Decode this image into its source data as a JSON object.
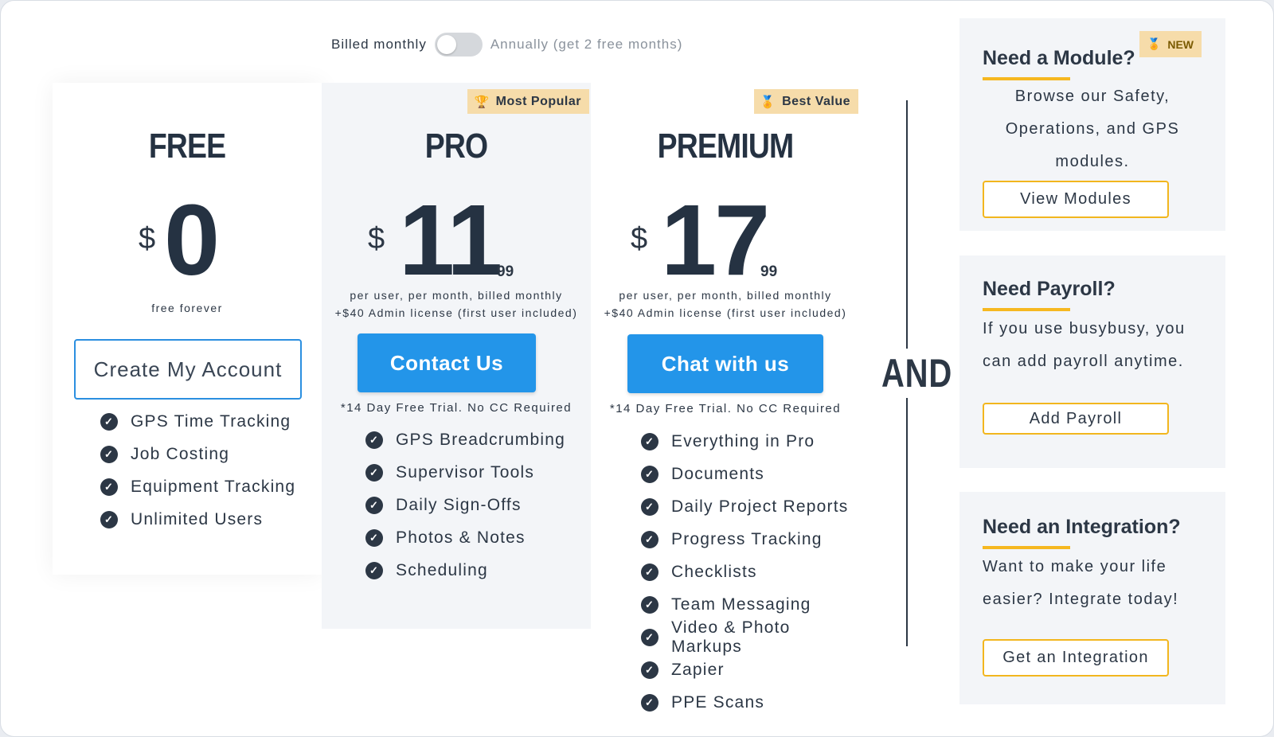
{
  "billing": {
    "monthly_label": "Billed monthly",
    "annual_label": "Annually (get 2 free months)",
    "toggle_state": "monthly"
  },
  "plans": [
    {
      "name": "FREE",
      "currency": "$",
      "price": "0",
      "cents": "",
      "note": "free forever",
      "cta": "Create My Account",
      "features": [
        "GPS Time Tracking",
        "Job Costing",
        "Equipment Tracking",
        "Unlimited Users"
      ]
    },
    {
      "name": "PRO",
      "ribbon": "Most Popular",
      "ribbon_icon": "trophy-icon",
      "currency": "$",
      "price": "11",
      "cents": "99",
      "note_line1": "per user, per month, billed monthly",
      "note_line2": "+$40 Admin license (first user included)",
      "cta": "Contact Us",
      "trial": "*14 Day Free Trial. No CC Required",
      "features": [
        "GPS Breadcrumbing",
        "Supervisor Tools",
        "Daily Sign-Offs",
        "Photos & Notes",
        "Scheduling"
      ]
    },
    {
      "name": "PREMIUM",
      "ribbon": "Best Value",
      "ribbon_icon": "medal-icon",
      "currency": "$",
      "price": "17",
      "cents": "99",
      "note_line1": "per user, per month, billed monthly",
      "note_line2": "+$40 Admin license (first user included)",
      "cta": "Chat with us",
      "trial": "*14 Day Free Trial. No CC Required",
      "features": [
        "Everything in Pro",
        "Documents",
        "Daily Project Reports",
        "Progress Tracking",
        "Checklists",
        "Team Messaging",
        "Video & Photo Markups",
        "Zapier",
        "PPE Scans"
      ]
    }
  ],
  "and_label": "AND",
  "cards": {
    "module": {
      "badge": "NEW",
      "title": "Need a Module?",
      "body_lines": [
        "Browse our Safety,",
        "Operations, and GPS",
        "modules."
      ],
      "cta": "View Modules"
    },
    "payroll": {
      "title": "Need Payroll?",
      "body_lines": [
        "If you use busybusy, you",
        "can add payroll anytime."
      ],
      "cta": "Add Payroll"
    },
    "integration": {
      "title": "Need an Integration?",
      "body_lines": [
        "Want to make your life",
        "easier? Integrate today!"
      ],
      "cta": "Get an Integration"
    }
  },
  "colors": {
    "accent_blue": "#2395e9",
    "accent_yellow": "#f2b61e",
    "ribbon_bg": "#f6dcaa",
    "text_dark": "#2c3745"
  }
}
